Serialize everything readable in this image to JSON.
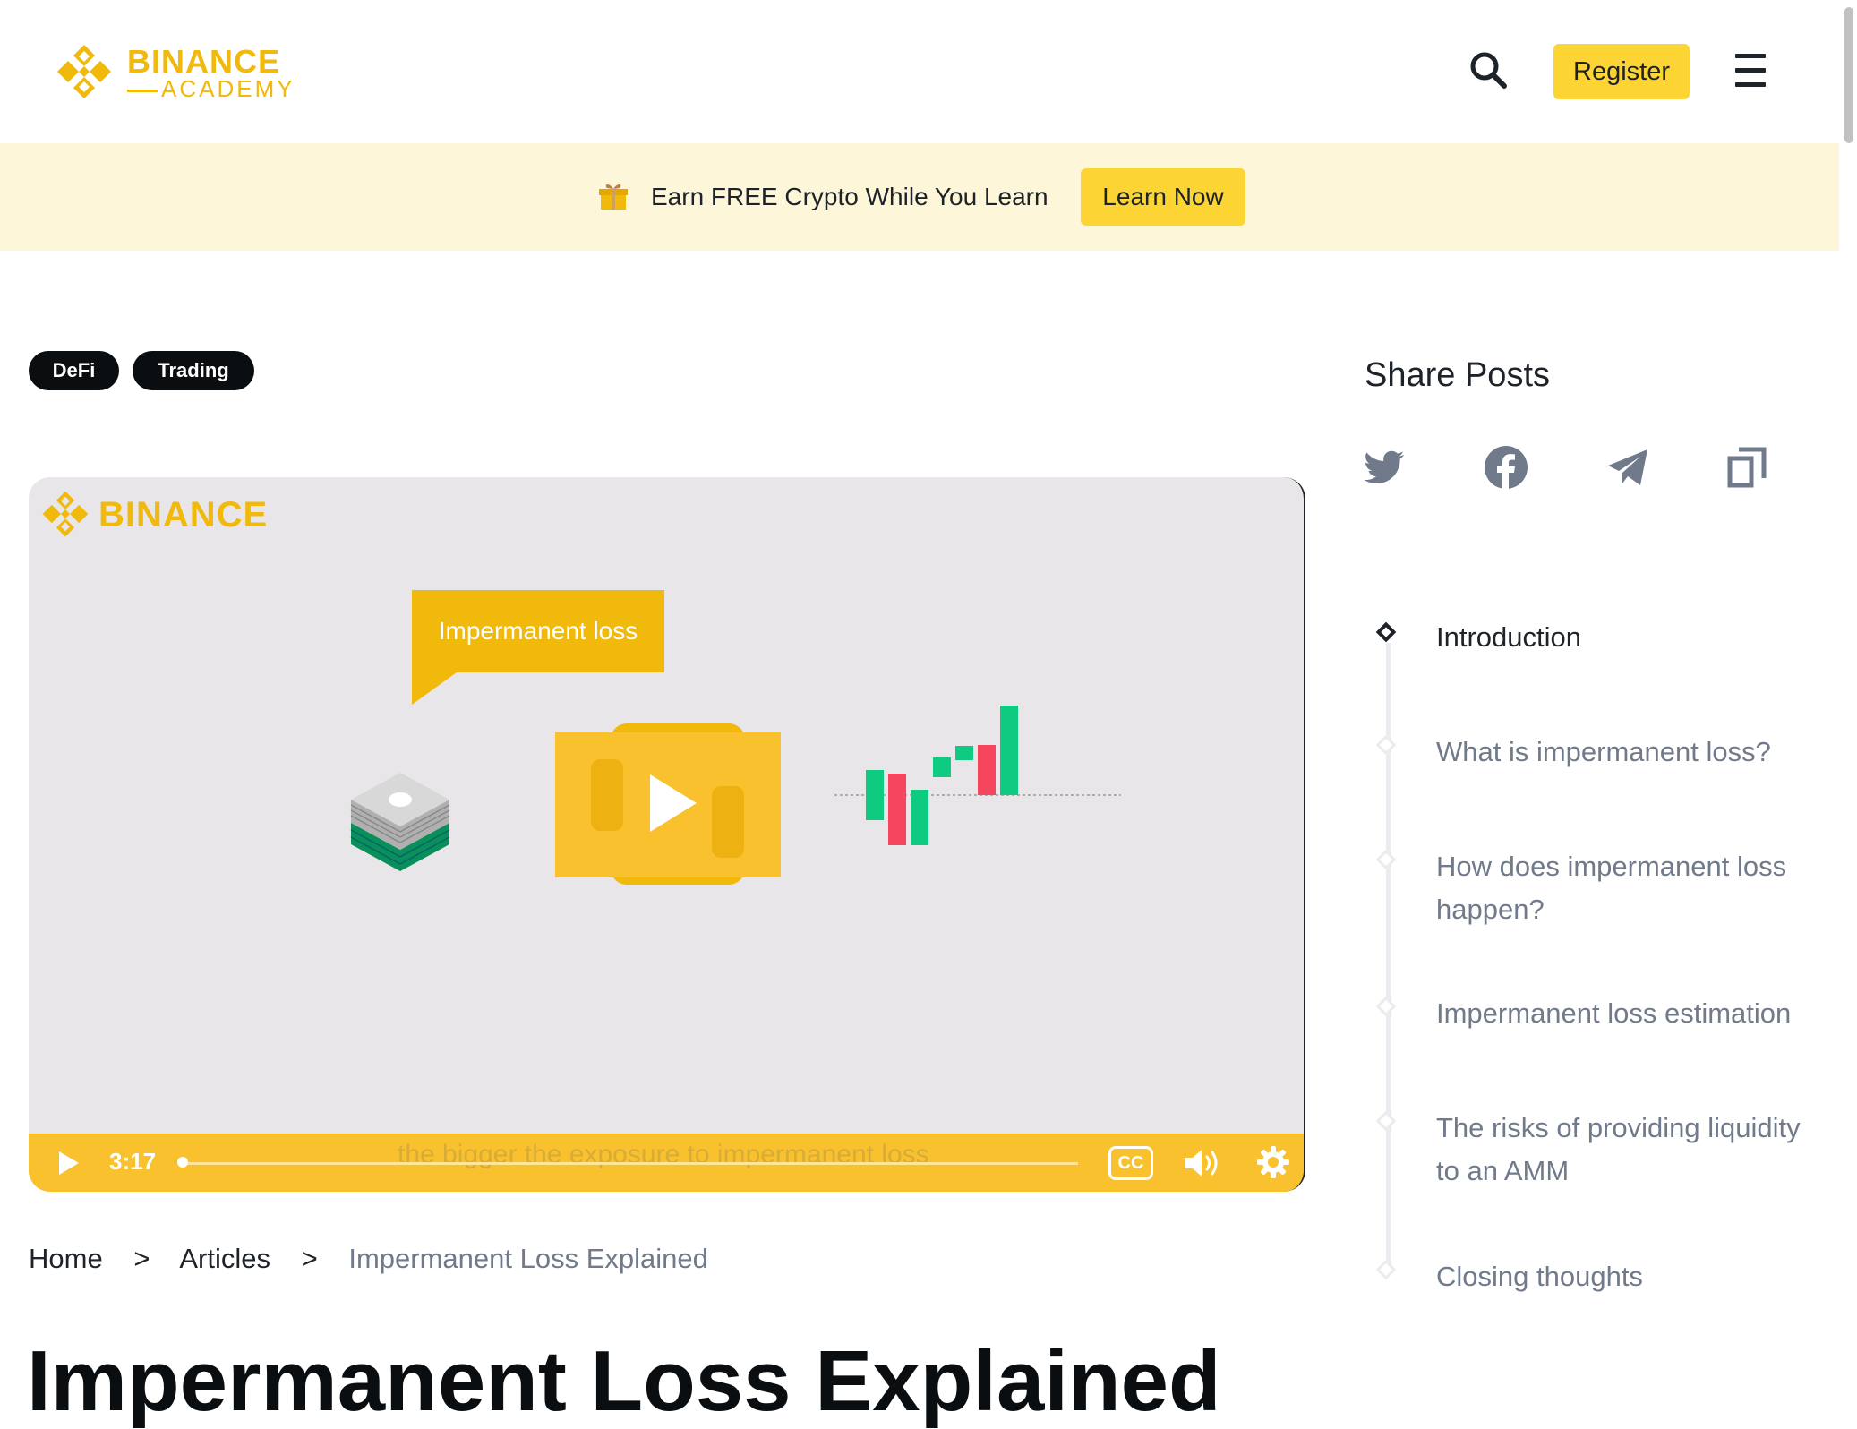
{
  "header": {
    "logo_line1": "BINANCE",
    "logo_line2": "ACADEMY",
    "register_label": "Register"
  },
  "promo": {
    "text": "Earn FREE Crypto While You Learn",
    "button_label": "Learn Now"
  },
  "tags": [
    "DeFi",
    "Trading"
  ],
  "video": {
    "logo_text": "BINANCE",
    "bubble_text": "Impermanent loss",
    "time": "3:17",
    "caption": "the bigger the exposure to impermanent loss",
    "cc_label": "CC",
    "progress": 0.0
  },
  "breadcrumb": {
    "home": "Home",
    "sep": ">",
    "articles": "Articles",
    "current": "Impermanent Loss Explained"
  },
  "article": {
    "title": "Impermanent Loss Explained"
  },
  "share": {
    "title": "Share Posts",
    "icons": [
      "twitter-icon",
      "facebook-icon",
      "telegram-icon",
      "copy-link-icon"
    ]
  },
  "toc": {
    "items": [
      "Introduction",
      "What is impermanent loss?",
      "How does impermanent loss happen?",
      "Impermanent loss estimation",
      "The risks of providing liquidity to an AMM",
      "Closing thoughts"
    ],
    "active_index": 0
  },
  "colors": {
    "brand_yellow": "#f0b90b",
    "button_yellow": "#fcd535",
    "promo_bg": "#fdf6d8",
    "tag_bg": "#0b0e11",
    "muted_text": "#707a8a"
  }
}
